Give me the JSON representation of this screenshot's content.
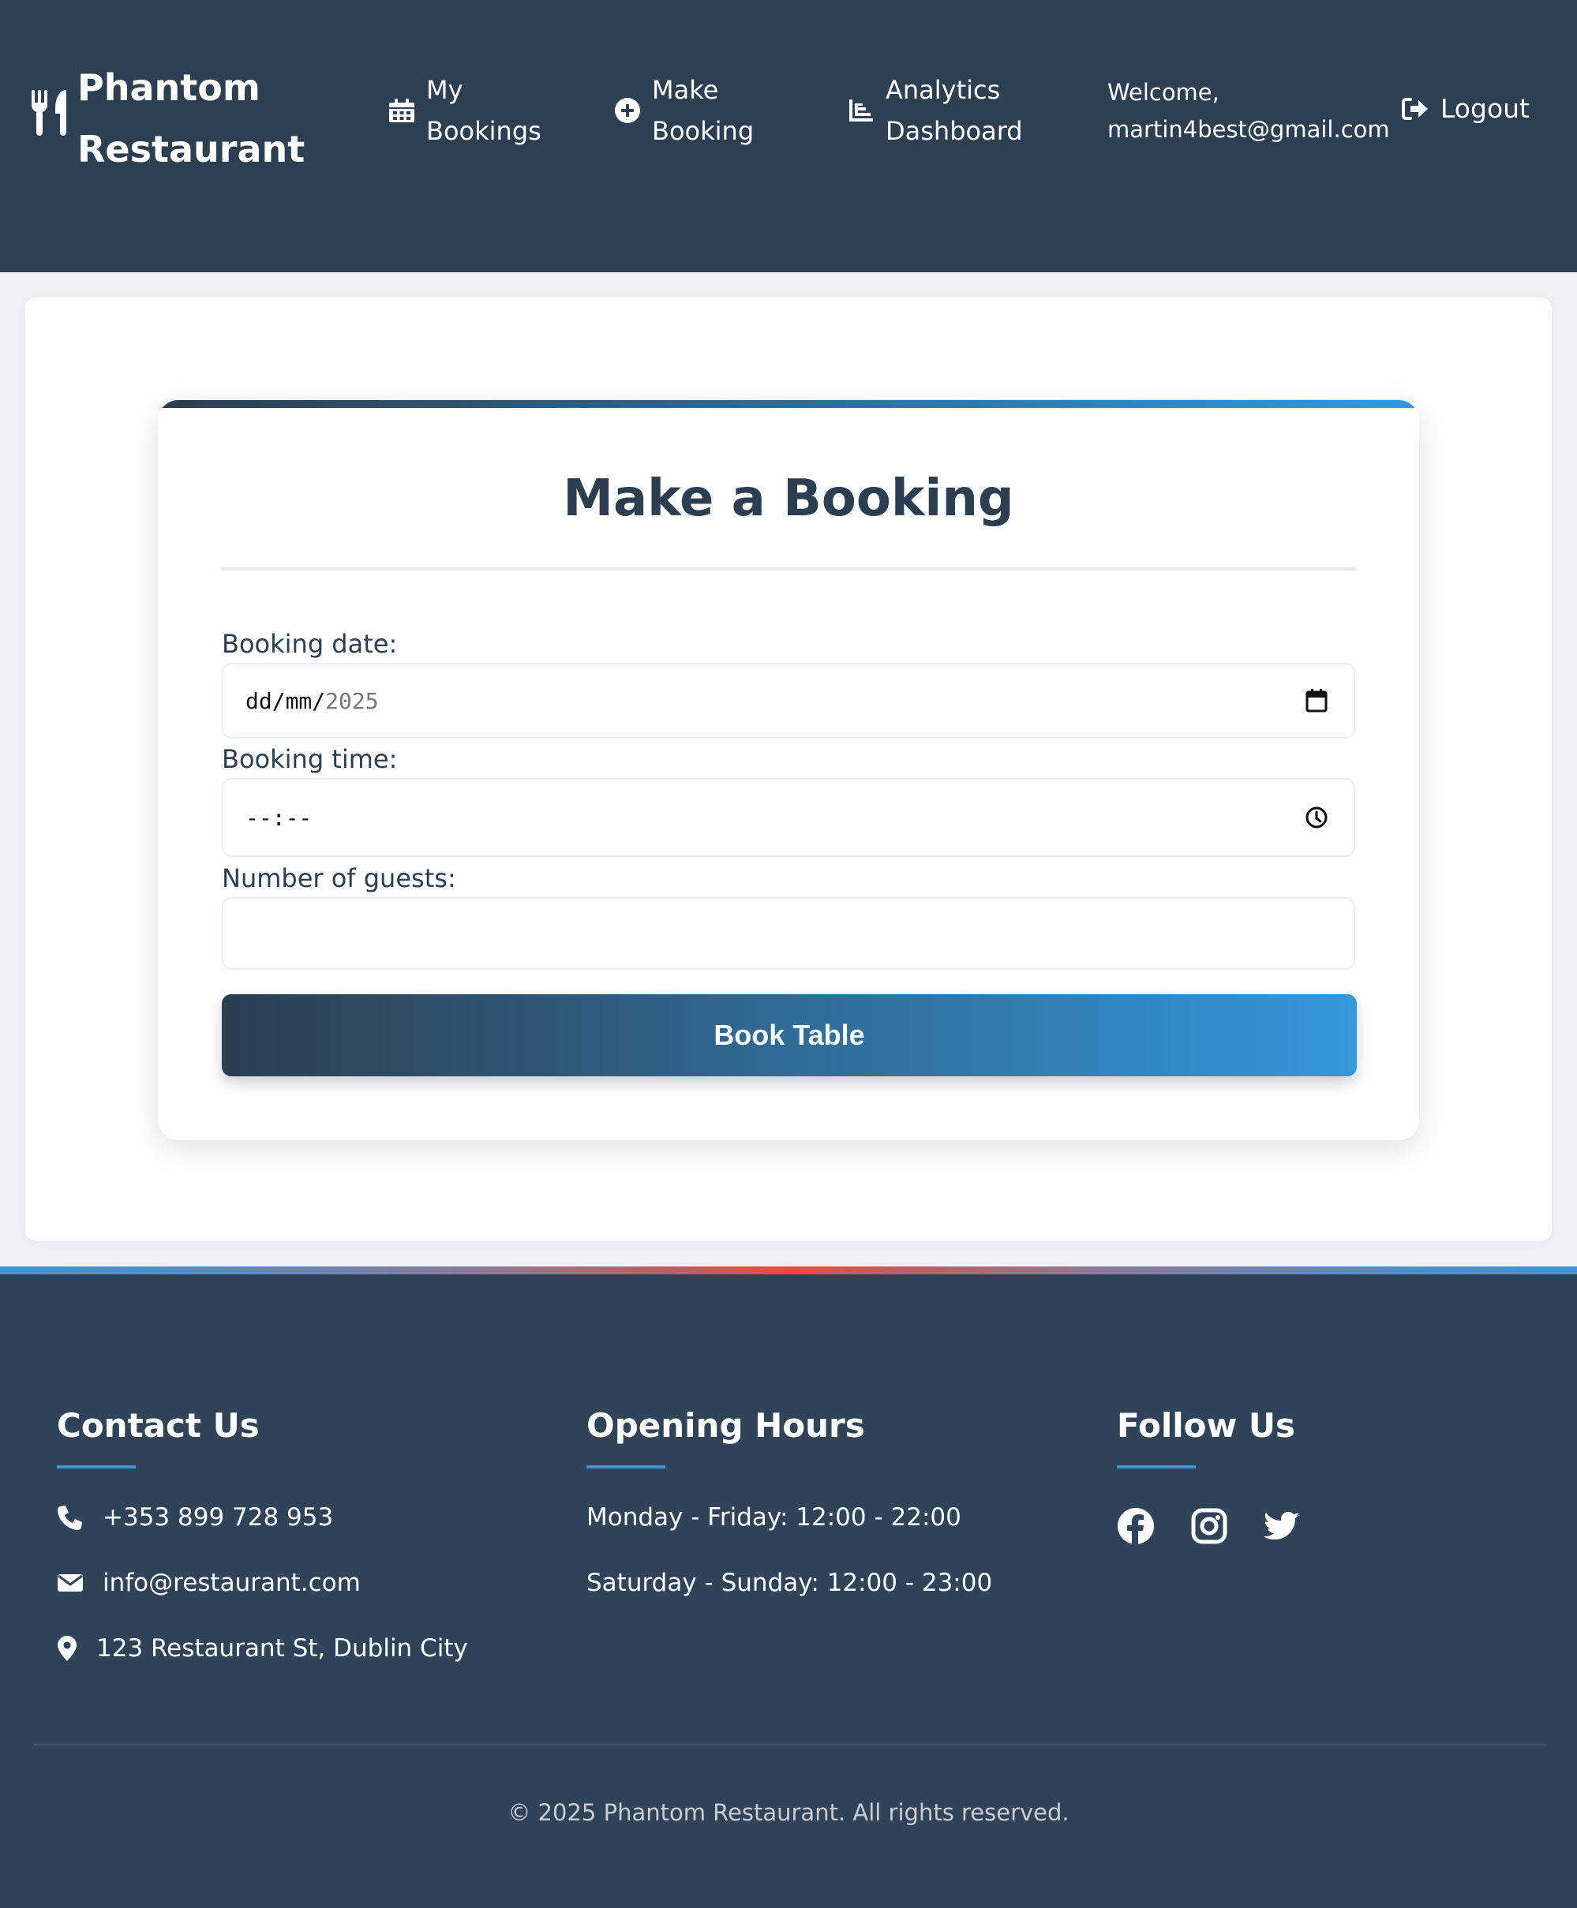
{
  "header": {
    "brand": "Phantom Restaurant",
    "nav": {
      "my_bookings": "My Bookings",
      "make_booking": "Make Booking",
      "analytics": "Analytics Dashboard"
    },
    "welcome": "Welcome, martin4best@gmail.com",
    "logout": "Logout"
  },
  "form": {
    "title": "Make a Booking",
    "date_label": "Booking date:",
    "date_value_prefix": "dd/mm/",
    "date_value_year": "2025",
    "time_label": "Booking time:",
    "time_value": "--:--",
    "guests_label": "Number of guests:",
    "guests_value": "",
    "submit": "Book Table"
  },
  "footer": {
    "contact": {
      "heading": "Contact Us",
      "phone": "+353 899 728 953",
      "email": "info@restaurant.com",
      "address": "123 Restaurant St, Dublin City"
    },
    "hours": {
      "heading": "Opening Hours",
      "weekday": "Monday - Friday: 12:00 - 22:00",
      "weekend": "Saturday - Sunday: 12:00 - 23:00"
    },
    "follow": {
      "heading": "Follow Us",
      "icons": [
        "facebook-icon",
        "instagram-icon",
        "twitter-icon"
      ]
    },
    "copyright": "© 2025 Phantom Restaurant. All rights reserved."
  },
  "colors": {
    "header_bg": "#2e3f52",
    "footer_bg": "#314357",
    "accent_blue": "#3498db",
    "accent_red": "#e74c3c",
    "title_text": "#2c3e50"
  }
}
